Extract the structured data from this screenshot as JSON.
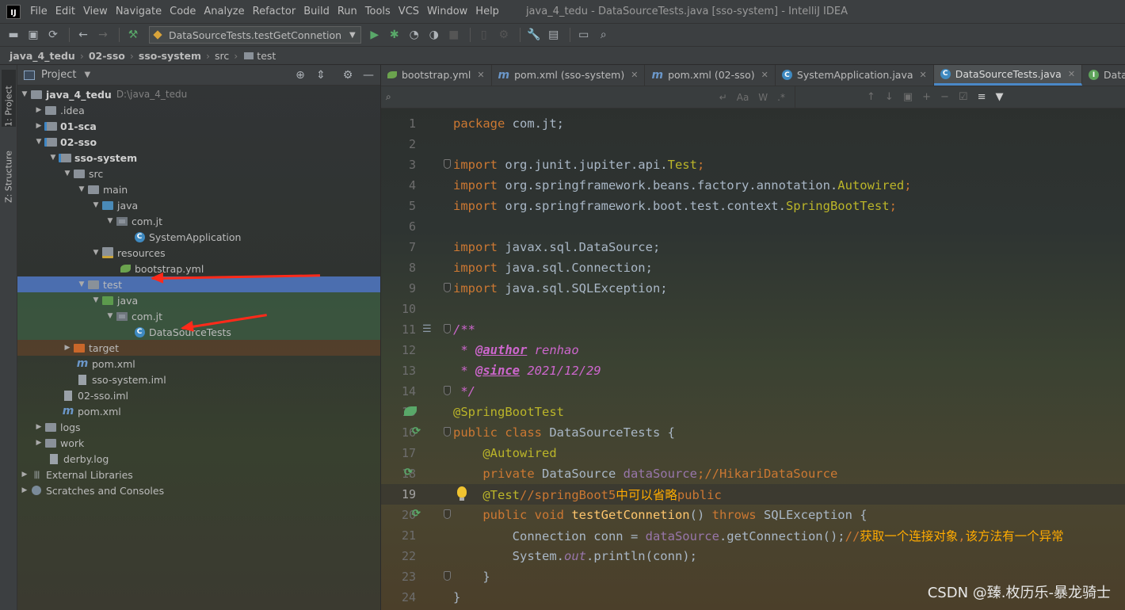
{
  "menu": {
    "logo": "IJ",
    "items": [
      "File",
      "Edit",
      "View",
      "Navigate",
      "Code",
      "Analyze",
      "Refactor",
      "Build",
      "Run",
      "Tools",
      "VCS",
      "Window",
      "Help"
    ],
    "window_title": "java_4_tedu - DataSourceTests.java [sso-system] - IntelliJ IDEA"
  },
  "toolbar": {
    "run_config": "DataSourceTests.testGetConnetion"
  },
  "breadcrumb": [
    "java_4_tedu",
    "02-sso",
    "sso-system",
    "src",
    "test"
  ],
  "stripe": {
    "project": "1: Project",
    "structure": "Z: Structure"
  },
  "panel": {
    "title": "Project"
  },
  "tree": [
    {
      "label": "java_4_tedu",
      "hint": "D:\\java_4_tedu"
    },
    {
      "label": ".idea"
    },
    {
      "label": "01-sca"
    },
    {
      "label": "02-sso"
    },
    {
      "label": "sso-system"
    },
    {
      "label": "src"
    },
    {
      "label": "main"
    },
    {
      "label": "java"
    },
    {
      "label": "com.jt"
    },
    {
      "label": "SystemApplication"
    },
    {
      "label": "resources"
    },
    {
      "label": "bootstrap.yml"
    },
    {
      "label": "test"
    },
    {
      "label": "java"
    },
    {
      "label": "com.jt"
    },
    {
      "label": "DataSourceTests"
    },
    {
      "label": "target"
    },
    {
      "label": "pom.xml"
    },
    {
      "label": "sso-system.iml"
    },
    {
      "label": "02-sso.iml"
    },
    {
      "label": "pom.xml"
    },
    {
      "label": "logs"
    },
    {
      "label": "work"
    },
    {
      "label": "derby.log"
    },
    {
      "label": "External Libraries"
    },
    {
      "label": "Scratches and Consoles"
    }
  ],
  "tabs": [
    {
      "label": "bootstrap.yml"
    },
    {
      "label": "pom.xml (sso-system)"
    },
    {
      "label": "pom.xml (02-sso)"
    },
    {
      "label": "SystemApplication.java"
    },
    {
      "label": "DataSourceTests.java"
    },
    {
      "label": "DataSource.java"
    }
  ],
  "find": {
    "case_label": "Aa",
    "word_label": "W",
    "regex_label": ".*"
  },
  "code": {
    "line_numbers": [
      "1",
      "2",
      "3",
      "4",
      "5",
      "6",
      "7",
      "8",
      "9",
      "10",
      "11",
      "12",
      "13",
      "14",
      "15",
      "16",
      "17",
      "18",
      "19",
      "20",
      "21",
      "22",
      "23",
      "24"
    ],
    "current_line": "19",
    "l1_kw": "package",
    "l1_rest": " com.jt;",
    "import_kw": "import",
    "l3_pkg": " org.junit.jupiter.api.",
    "l3_cls": "Test",
    "l3_end": ";",
    "l4_pkg": " org.springframework.beans.factory.annotation.",
    "l4_cls": "Autowired",
    "l4_end": ";",
    "l5_pkg": " org.springframework.boot.test.context.",
    "l5_cls": "SpringBootTest",
    "l5_end": ";",
    "l7_rest": " javax.sql.DataSource;",
    "l8_rest": " java.sql.Connection;",
    "l9_rest": " java.sql.SQLException;",
    "l11": "/**",
    "l12_star": " * ",
    "l12_tag": "@author",
    "l12_val": " renhao",
    "l13_star": " * ",
    "l13_tag": "@since",
    "l13_val": " 2021/12/29",
    "l14": " */",
    "l15": "@SpringBootTest",
    "l16_kw": "public class",
    "l16_rest": " DataSourceTests {",
    "l17_ann": "@Autowired",
    "l18_kw": "private",
    "l18_type": " DataSource ",
    "l18_field": "dataSource",
    "l18_semi": ";",
    "l18_cmt": "//HikariDataSource",
    "l19_ann": "@Test",
    "l19_cmt": "//springBoot5",
    "l19_cn": "中可以省略",
    "l19_cmt2": "public",
    "l20_kw": "public void",
    "l20_meth": " testGetConnetion",
    "l20_mid": "() ",
    "l20_throws": "throws",
    "l20_rest": " SQLException {",
    "l21_pre": "Connection conn = ",
    "l21_field": "dataSource",
    "l21_mid": ".getConnection();",
    "l21_cmt": "//",
    "l21_cn": "获取一个连接对象",
    "l21_cmt2": ",",
    "l21_cn2": "该方法有一个异常",
    "l22_pre": "System.",
    "l22_stat": "out",
    "l22_rest": ".println(conn);",
    "l23": "}",
    "l24": "}"
  },
  "watermark": "CSDN @臻.枚历乐-暴龙骑士"
}
